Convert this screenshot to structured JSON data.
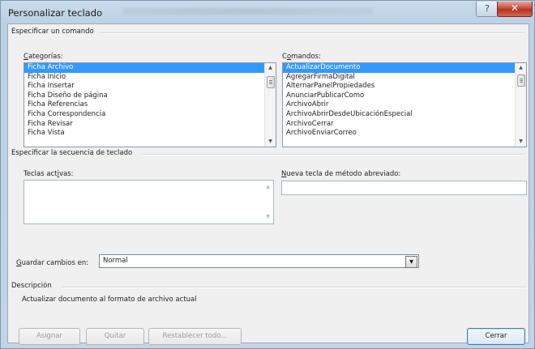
{
  "window": {
    "title": "Personalizar teclado",
    "help_glyph": "?",
    "close_glyph": "✕"
  },
  "command_section": {
    "title": "Especificar un comando",
    "categories_label_u": "C",
    "categories_label_rest": "ategorías:",
    "categories": [
      "Ficha Archivo",
      "Ficha Inicio",
      "Ficha Insertar",
      "Ficha Diseño de página",
      "Ficha Referencias",
      "Ficha Correspondencia",
      "Ficha Revisar",
      "Ficha Vista"
    ],
    "categories_selected": "Ficha Archivo",
    "commands_label_pre": "C",
    "commands_label_u": "o",
    "commands_label_rest": "mandos:",
    "commands": [
      "ActualizarDocumento",
      "AgregarFirmaDigital",
      "AlternarPanelPropiedades",
      "AnunciarPublicarComo",
      "ArchivoAbrir",
      "ArchivoAbrirDesdeUbicaciónEspecial",
      "ArchivoCerrar",
      "ArchivoEnviarCorreo"
    ],
    "commands_selected": "ActualizarDocumento"
  },
  "keyboard_section": {
    "title": "Especificar la secuencia de teclado",
    "current_keys_label_pre": "Teclas act",
    "current_keys_label_u": "i",
    "current_keys_label_rest": "vas:",
    "new_key_label_u": "N",
    "new_key_label_rest": "ueva tecla de método abreviado:",
    "new_key_value": ""
  },
  "save_in": {
    "label_u": "G",
    "label_rest": "uardar cambios en:",
    "value": "Normal"
  },
  "description": {
    "title": "Descripción",
    "text": "Actualizar documento al formato de archivo actual"
  },
  "buttons": {
    "assign": "Asignar",
    "remove": "Quitar",
    "reset_all": "Restablecer todo...",
    "close": "Cerrar"
  },
  "colors": {
    "selection": "#3399ff",
    "close_button": "#c7503f"
  }
}
